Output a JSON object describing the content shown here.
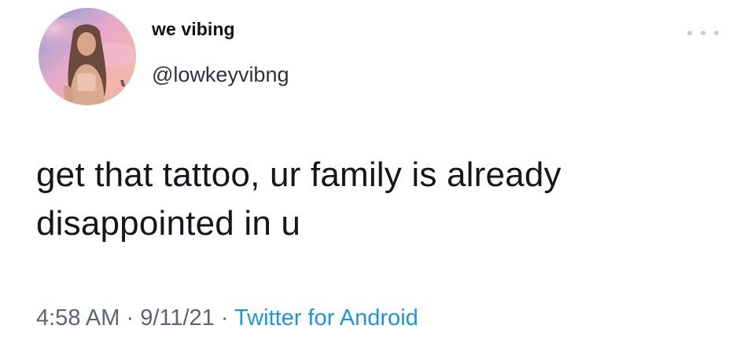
{
  "user": {
    "display_name": "we vibing",
    "handle": "@lowkeyvibng"
  },
  "menu": {
    "icon": "more-dots-icon"
  },
  "tweet": {
    "line1": "get that tattoo, ur family is already",
    "line2": "disappointed in u"
  },
  "meta": {
    "time": "4:58 AM",
    "separator1": " · ",
    "date": "9/11/21",
    "separator2": " · ",
    "app": "Twitter for Android"
  },
  "colors": {
    "text": "#0f1419",
    "meta_gray": "#5b6670",
    "link_blue": "#1b95e0",
    "avatar_sky_pink": "#e9a6c0",
    "avatar_sky_blue": "#8ea6d8"
  }
}
